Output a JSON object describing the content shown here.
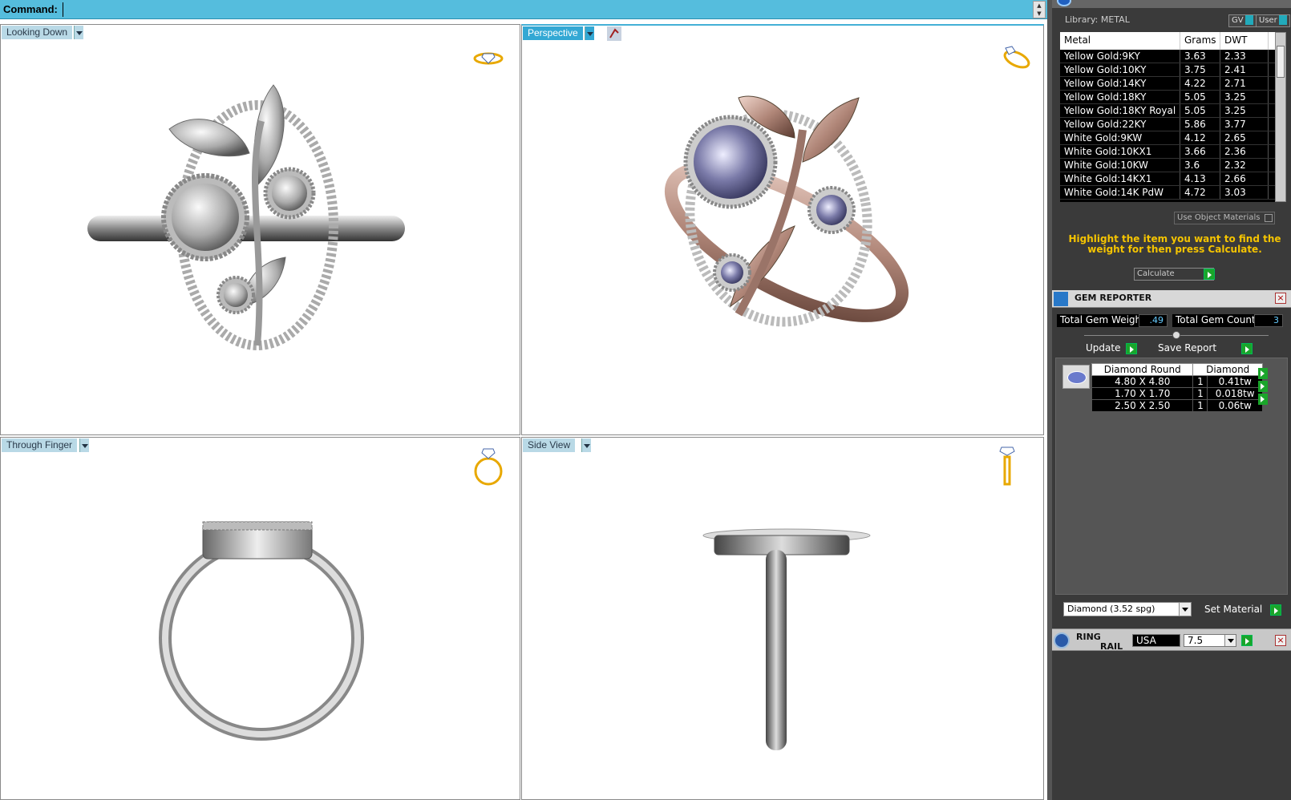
{
  "command": {
    "label": "Command:",
    "value": ""
  },
  "viewports": {
    "top_left": {
      "label": "Looking Down"
    },
    "top_right": {
      "label": "Perspective"
    },
    "bottom_left": {
      "label": "Through Finger"
    },
    "bottom_right": {
      "label": "Side View"
    }
  },
  "library": {
    "label": "Library: METAL",
    "gv_label": "GV",
    "user_label": "User",
    "columns": [
      "Metal",
      "Grams",
      "DWT"
    ],
    "rows": [
      [
        "Yellow Gold:9KY",
        "3.63",
        "2.33"
      ],
      [
        "Yellow Gold:10KY",
        "3.75",
        "2.41"
      ],
      [
        "Yellow Gold:14KY",
        "4.22",
        "2.71"
      ],
      [
        "Yellow Gold:18KY",
        "5.05",
        "3.25"
      ],
      [
        "Yellow Gold:18KY Royal",
        "5.05",
        "3.25"
      ],
      [
        "Yellow Gold:22KY",
        "5.86",
        "3.77"
      ],
      [
        "White Gold:9KW",
        "4.12",
        "2.65"
      ],
      [
        "White Gold:10KX1",
        "3.66",
        "2.36"
      ],
      [
        "White Gold:10KW",
        "3.6",
        "2.32"
      ],
      [
        "White Gold:14KX1",
        "4.13",
        "2.66"
      ],
      [
        "White Gold:14K PdW",
        "4.72",
        "3.03"
      ]
    ],
    "use_object_materials": "Use Object Materials",
    "hint": "Highlight the item you want to find the weight for then press Calculate.",
    "calculate": "Calculate"
  },
  "gem_reporter": {
    "title": "GEM REPORTER",
    "total_weight_label": "Total Gem Weight",
    "total_weight": ".49",
    "total_count_label": "Total Gem Count",
    "total_count": "3",
    "update": "Update",
    "save_report": "Save Report",
    "headers": [
      "Diamond Round",
      "Diamond"
    ],
    "rows": [
      [
        "4.80 X 4.80",
        "1",
        "0.41tw"
      ],
      [
        "1.70 X 1.70",
        "1",
        "0.018tw"
      ],
      [
        "2.50 X 2.50",
        "1",
        "0.06tw"
      ]
    ],
    "material_select": "Diamond    (3.52 spg)",
    "set_material": "Set Material"
  },
  "ring_rail": {
    "title_line1": "RING",
    "title_line2": "RAIL",
    "country": "USA",
    "size": "7.5"
  },
  "colors": {
    "accent": "#33a8d4",
    "hint": "#f5c400",
    "go": "#1aa52a"
  }
}
